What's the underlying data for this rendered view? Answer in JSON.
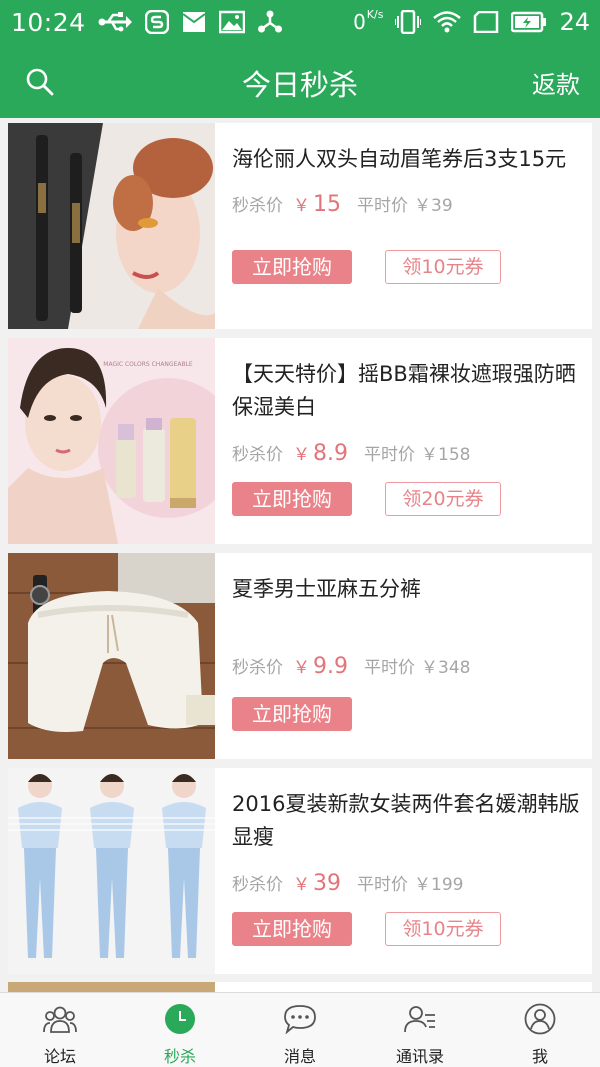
{
  "status_bar": {
    "time": "10:24",
    "network_speed": "0",
    "network_unit": "K/s",
    "battery_level": "24",
    "left_icons": [
      "usb-icon",
      "s-app-icon",
      "mail-icon",
      "image-icon",
      "share-icon"
    ],
    "right_icons": [
      "vibrate-icon",
      "wifi-icon",
      "sim-icon",
      "battery-icon"
    ]
  },
  "header": {
    "title": "今日秒杀",
    "right_action": "返款",
    "search_icon": "search-icon"
  },
  "colors": {
    "brand_green": "#2aa95a",
    "seckill_red": "#e2747a",
    "buy_button": "#ea8389",
    "coupon_border": "#ec9aa0"
  },
  "products": [
    {
      "title": "海伦丽人双头自动眉笔券后3支15元",
      "seckill_label": "秒杀价",
      "currency": "￥",
      "seckill_price": "15",
      "normal_label": "平时价",
      "normal_price": "￥39",
      "buy_label": "立即抢购",
      "coupon_label": "领10元券"
    },
    {
      "title": "【天天特价】摇BB霜裸妆遮瑕强防晒保湿美白",
      "seckill_label": "秒杀价",
      "currency": "￥",
      "seckill_price": "8.9",
      "normal_label": "平时价",
      "normal_price": "￥158",
      "buy_label": "立即抢购",
      "coupon_label": "领20元券",
      "image_text": "MAGIC COLORS CHANGEABLE"
    },
    {
      "title": "夏季男士亚麻五分裤",
      "seckill_label": "秒杀价",
      "currency": "￥",
      "seckill_price": "9.9",
      "normal_label": "平时价",
      "normal_price": "￥348",
      "buy_label": "立即抢购"
    },
    {
      "title": "2016夏装新款女装两件套名媛潮韩版显瘦",
      "seckill_label": "秒杀价",
      "currency": "￥",
      "seckill_price": "39",
      "normal_label": "平时价",
      "normal_price": "￥199",
      "buy_label": "立即抢购",
      "coupon_label": "领10元券"
    }
  ],
  "bottom_nav": [
    {
      "label": "论坛",
      "icon": "forum-icon",
      "active": false
    },
    {
      "label": "秒杀",
      "icon": "clock-icon",
      "active": true
    },
    {
      "label": "消息",
      "icon": "message-icon",
      "active": false
    },
    {
      "label": "通讯录",
      "icon": "contacts-icon",
      "active": false
    },
    {
      "label": "我",
      "icon": "profile-icon",
      "active": false
    }
  ]
}
